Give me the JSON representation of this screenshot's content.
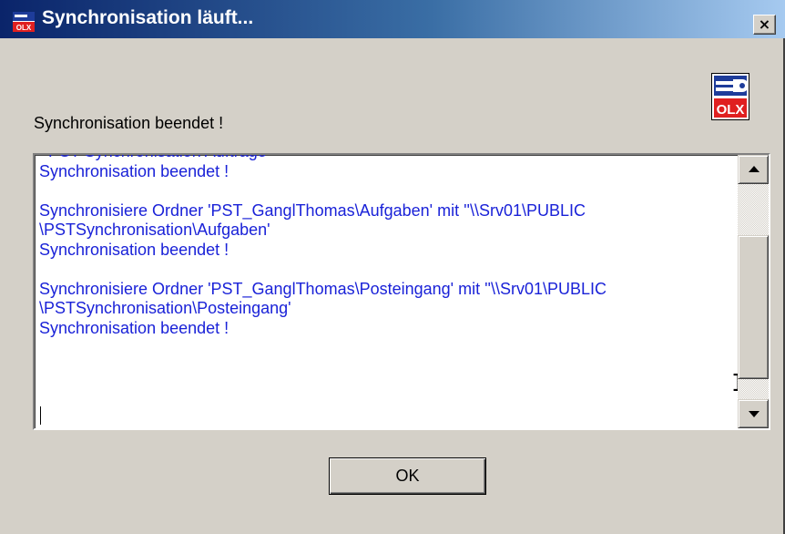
{
  "window": {
    "title": "Synchronisation läuft...",
    "close_label": "×",
    "app_icon": "olx-app-icon",
    "title_gradient": [
      "#0a246a",
      "#a6caf0"
    ]
  },
  "logo": {
    "name": "olx-logo-icon",
    "text": "OLX",
    "color": "#e02020"
  },
  "status": {
    "text": "Synchronisation beendet !"
  },
  "log": {
    "text_color": "#1a22d8",
    "lines": [
      "  PST Synchronisation Aufträge",
      "Synchronisation beendet !",
      "",
      "Synchronisiere Ordner 'PST_GanglThomas\\Aufgaben' mit ''\\\\Srv01\\PUBLIC",
      "\\PSTSynchronisation\\Aufgaben'",
      "Synchronisation beendet !",
      "",
      "Synchronisiere Ordner 'PST_GanglThomas\\Posteingang' mit ''\\\\Srv01\\PUBLIC",
      "\\PSTSynchronisation\\Posteingang'",
      "Synchronisation beendet !"
    ],
    "scroll_position": 0.72
  },
  "buttons": {
    "ok_label": "OK"
  }
}
